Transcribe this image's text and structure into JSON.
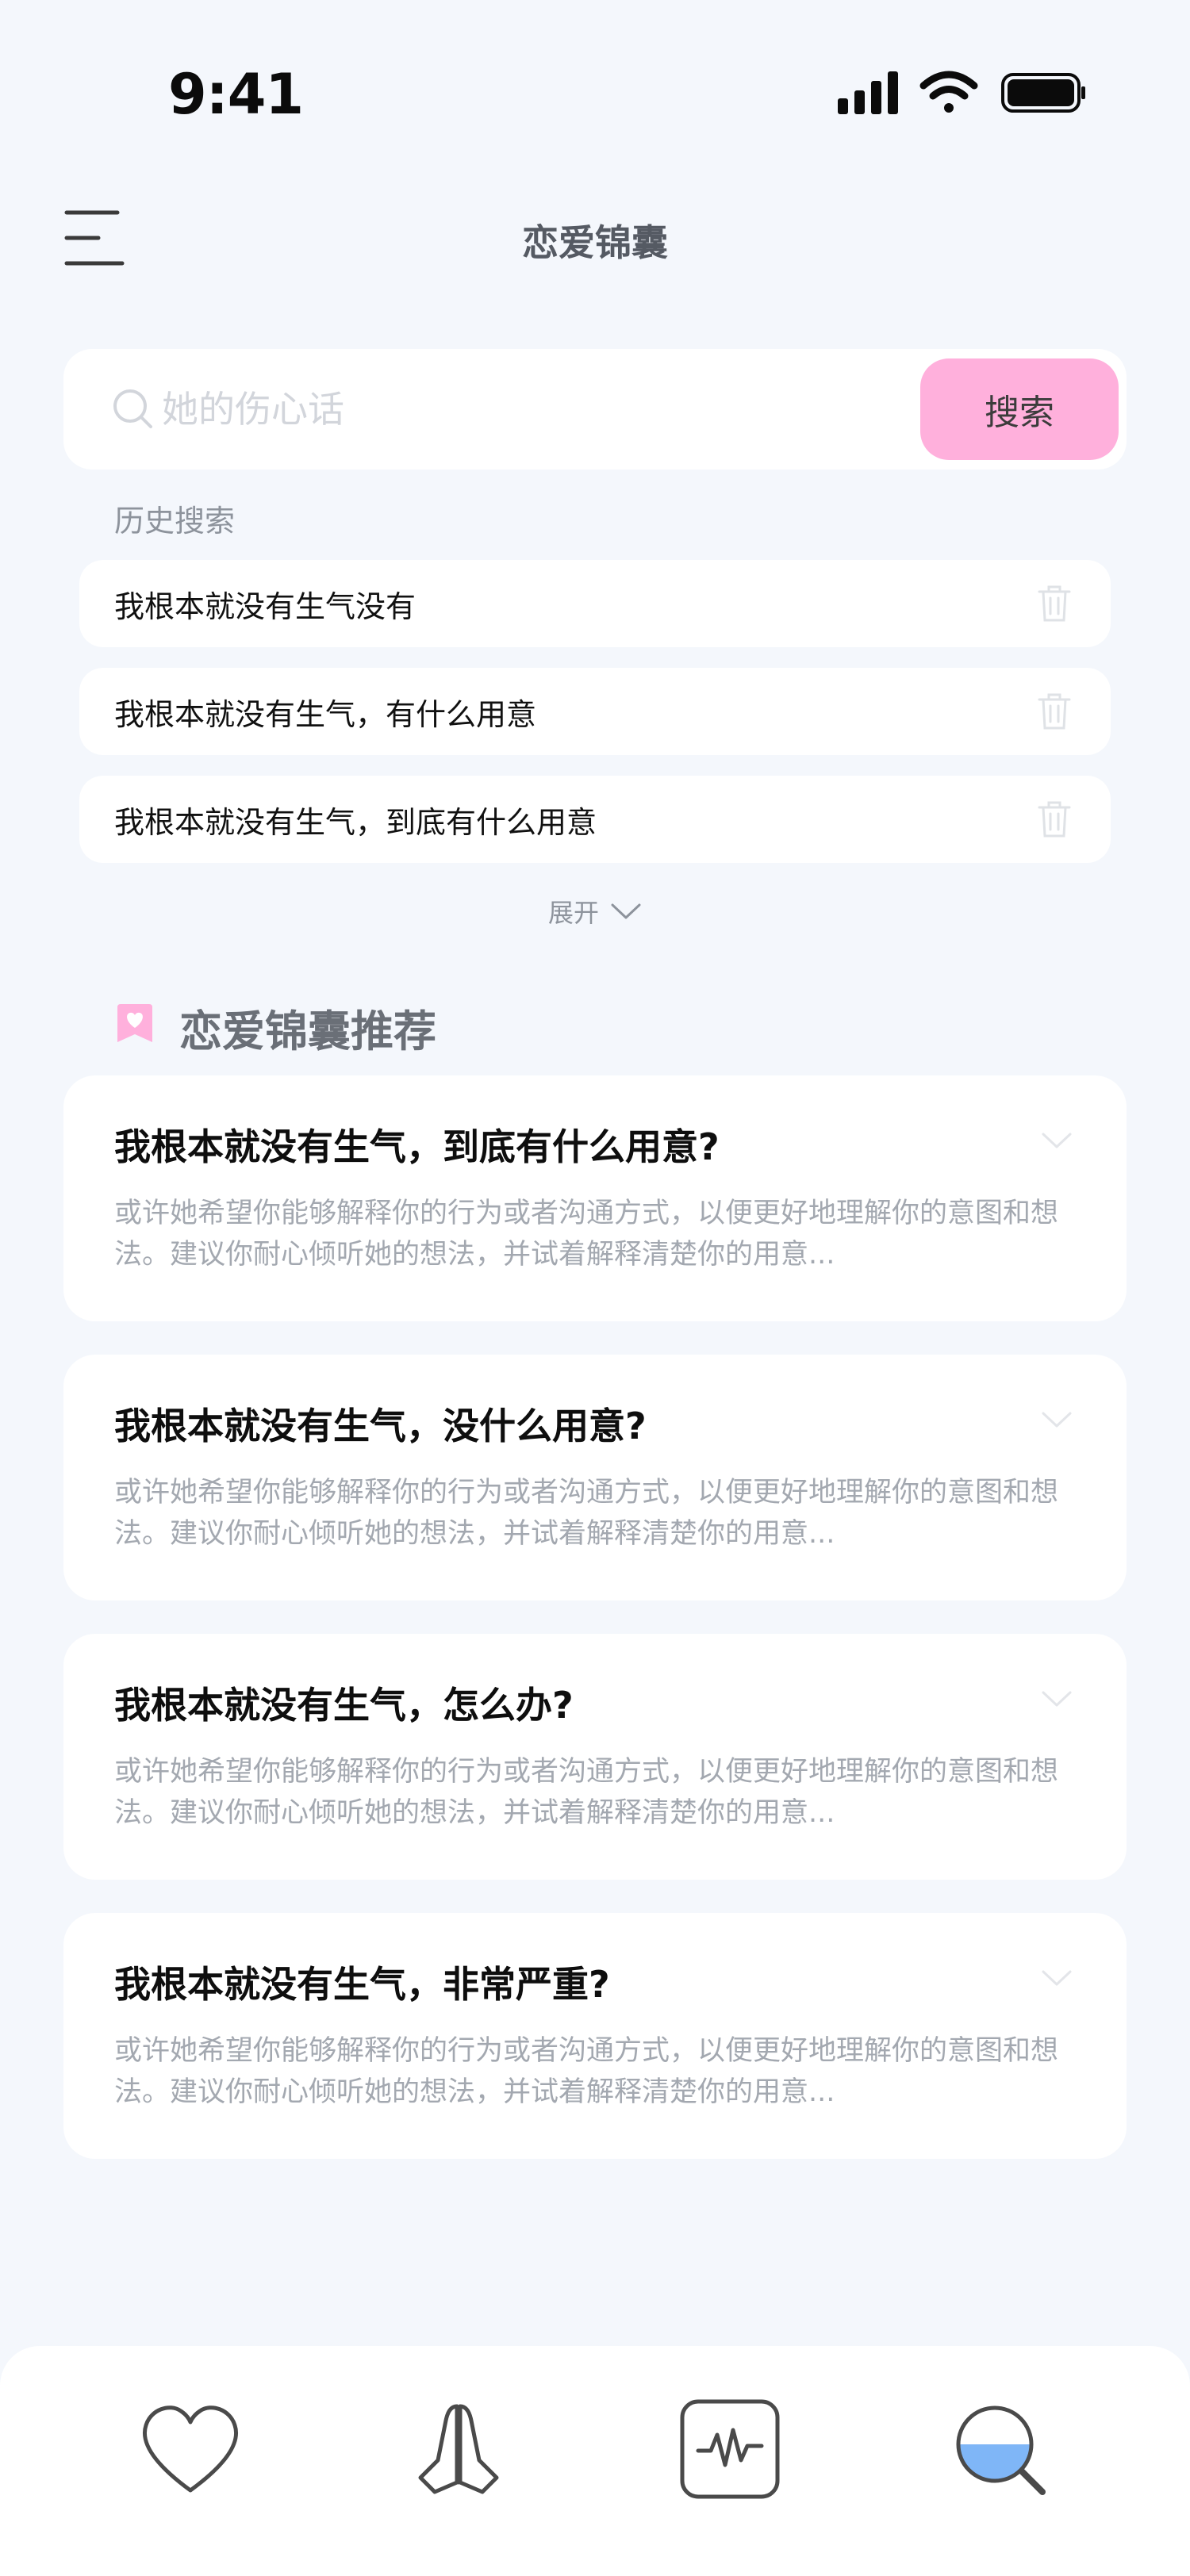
{
  "status_bar": {
    "time": "9:41"
  },
  "header": {
    "title": "恋爱锦囊"
  },
  "search": {
    "placeholder": "她的伤心话",
    "button_label": "搜索"
  },
  "history": {
    "label": "历史搜索",
    "items": [
      {
        "text": "我根本就没有生气没有"
      },
      {
        "text": "我根本就没有生气，有什么用意"
      },
      {
        "text": "我根本就没有生气，到底有什么用意"
      }
    ],
    "expand_label": "展开"
  },
  "recommend": {
    "title": "恋爱锦囊推荐",
    "cards": [
      {
        "title": "我根本就没有生气，到底有什么用意?",
        "desc": "或许她希望你能够解释你的行为或者沟通方式，以便更好地理解你的意图和想法。建议你耐心倾听她的想法，并试着解释清楚你的用意..."
      },
      {
        "title": "我根本就没有生气，没什么用意?",
        "desc": "或许她希望你能够解释你的行为或者沟通方式，以便更好地理解你的意图和想法。建议你耐心倾听她的想法，并试着解释清楚你的用意..."
      },
      {
        "title": "我根本就没有生气，怎么办?",
        "desc": "或许她希望你能够解释你的行为或者沟通方式，以便更好地理解你的意图和想法。建议你耐心倾听她的想法，并试着解释清楚你的用意..."
      },
      {
        "title": "我根本就没有生气，非常严重?",
        "desc": "或许她希望你能够解释你的行为或者沟通方式，以便更好地理解你的意图和想法。建议你耐心倾听她的想法，并试着解释清楚你的用意..."
      }
    ]
  },
  "bottom_nav": {
    "items": [
      {
        "icon": "heart-icon",
        "active": false
      },
      {
        "icon": "praying-hands-icon",
        "active": false
      },
      {
        "icon": "pulse-icon",
        "active": false
      },
      {
        "icon": "search-icon",
        "active": true
      }
    ]
  },
  "colors": {
    "background": "#f4f7fc",
    "accent_pink": "#ffb0dc",
    "active_blue": "#7fb6f7",
    "icon_gray": "#4a4a4a"
  }
}
